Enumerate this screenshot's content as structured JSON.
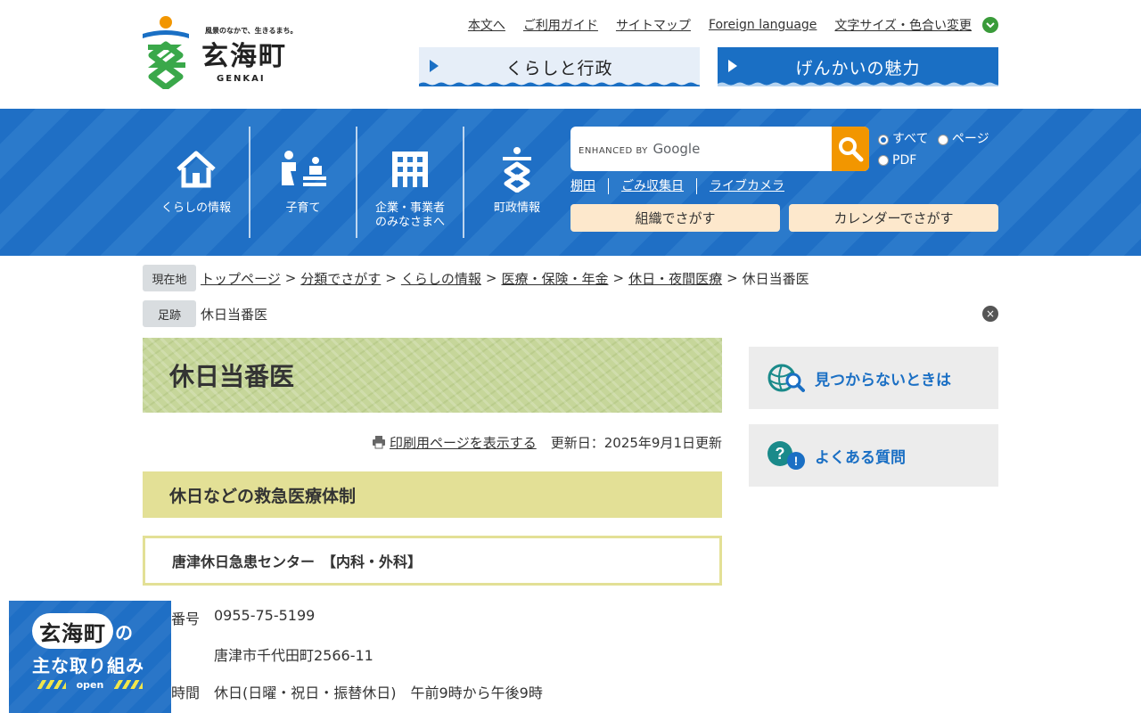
{
  "header": {
    "logo_tagline": "風景のなかで、生きるまち。",
    "logo_name": "玄海町",
    "logo_roman": "GENKAI",
    "util_links": [
      "本文へ",
      "ご利用ガイド",
      "サイトマップ",
      "Foreign language",
      "文字サイズ・色合い変更"
    ],
    "main_buttons": [
      "くらしと行政",
      "げんかいの魅力"
    ]
  },
  "nav": {
    "items": [
      "くらしの情報",
      "子育て",
      "企業・事業者\nのみなさまへ",
      "町政情報"
    ],
    "search": {
      "brand_prefix": "ENHANCED BY",
      "brand_name": "Google",
      "value": ""
    },
    "radio_options": [
      "すべて",
      "ページ",
      "PDF"
    ],
    "radio_selected": "すべて",
    "quick_links": [
      "棚田",
      "ごみ収集日",
      "ライブカメラ"
    ],
    "find_buttons": [
      "組織でさがす",
      "カレンダーでさがす"
    ]
  },
  "breadcrumb": {
    "label": "現在地",
    "items": [
      "トップページ",
      "分類でさがす",
      "くらしの情報",
      "医療・保険・年金",
      "休日・夜間医療"
    ],
    "current": "休日当番医",
    "separator": ">"
  },
  "footprint": {
    "label": "足跡",
    "item": "休日当番医",
    "close": "×"
  },
  "main": {
    "title": "休日当番医",
    "print_link": "印刷用ページを表示する",
    "updated": "更新日：2025年9月1日更新",
    "h2": "休日などの救急医療体制",
    "h3": "唐津休日急患センター　【内科・外科】",
    "info": [
      {
        "key": "番号",
        "value": "0955-75-5199"
      },
      {
        "key": "",
        "value": "唐津市千代田町2566-11"
      },
      {
        "key": "時間",
        "value": "休日(日曜・祝日・振替休日)　午前9時から午後9時"
      }
    ]
  },
  "sidebar": {
    "buttons": [
      "見つからないときは",
      "よくある質問"
    ]
  },
  "float_banner": {
    "name": "玄海町",
    "no": "の",
    "sub": "主な取り組み",
    "open": "open"
  },
  "colors": {
    "brand_blue": "#1f6fc5",
    "search_orange": "#f29600",
    "title_green": "#c6d69a",
    "h2_yellow": "#e3e096",
    "find_btn": "#fde8cc"
  }
}
